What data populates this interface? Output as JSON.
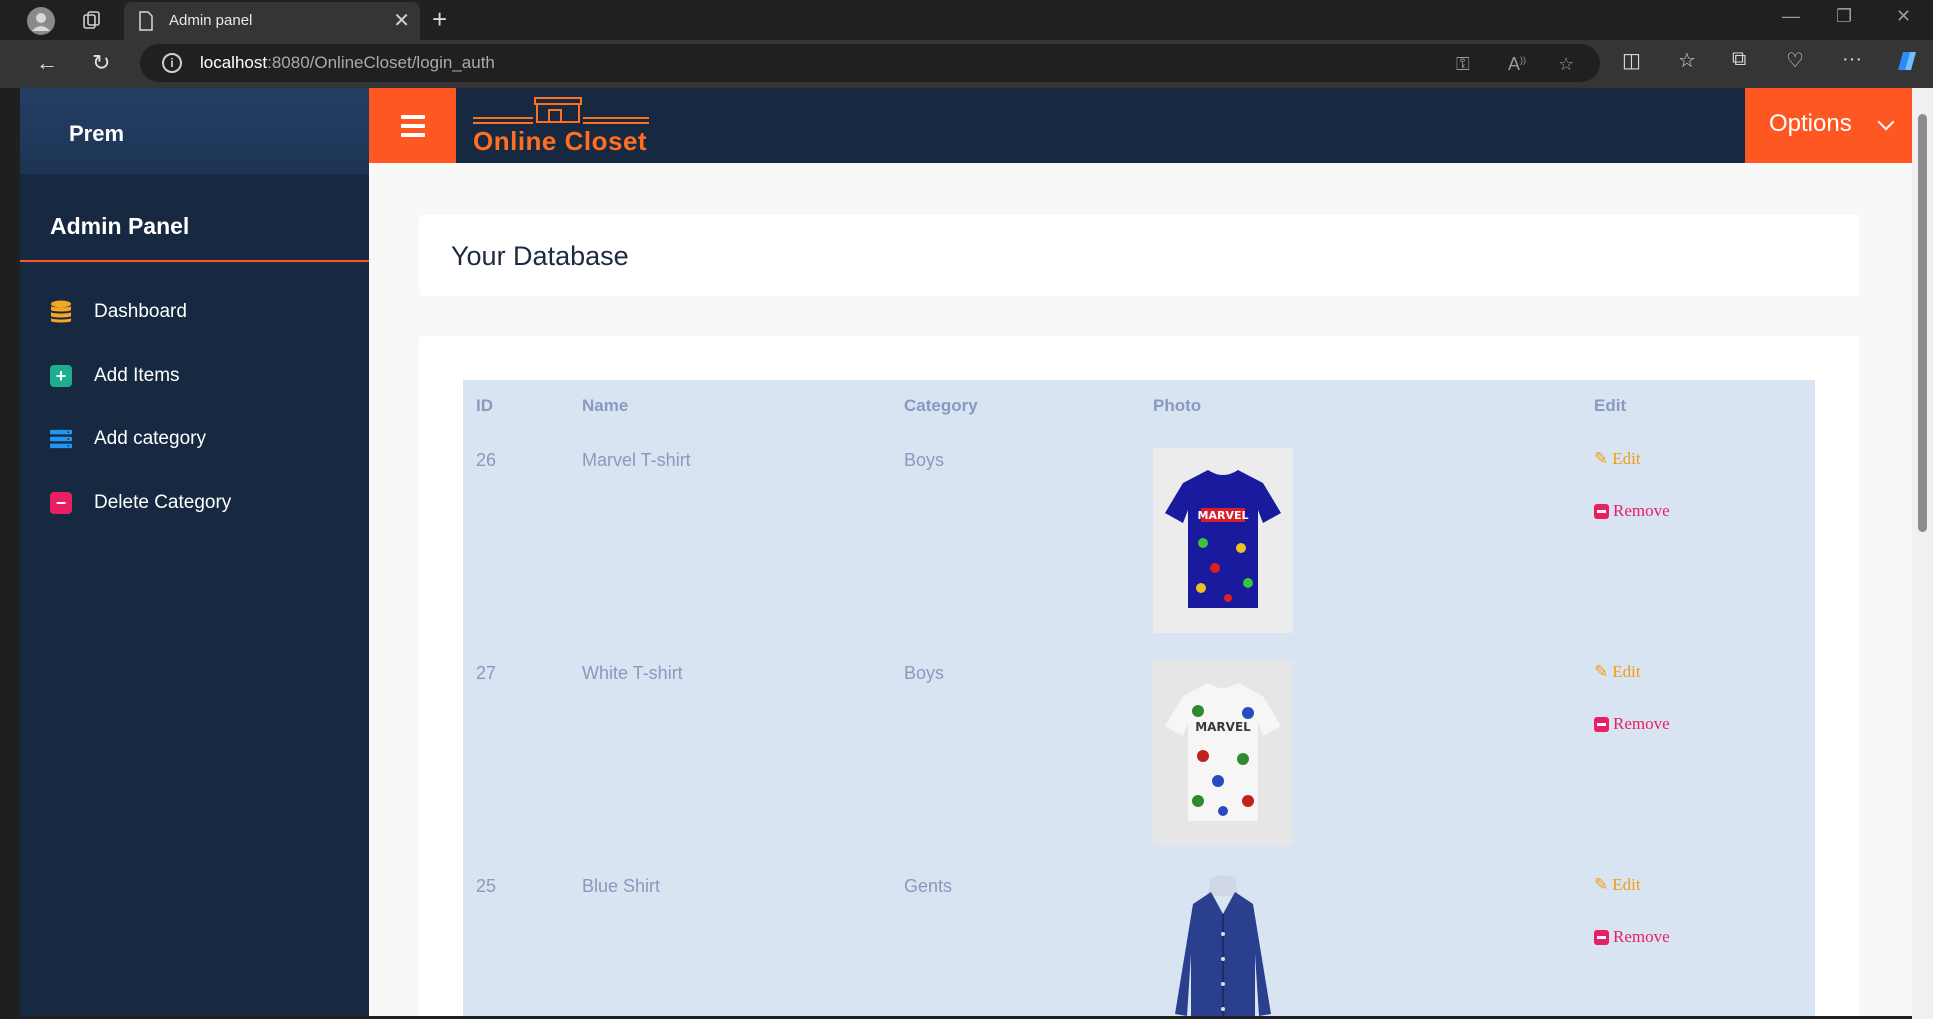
{
  "browser": {
    "tab_title": "Admin panel",
    "url_host": "localhost",
    "url_rest": ":8080/OnlineCloset/login_auth"
  },
  "sidebar": {
    "user": "Prem",
    "panel_title": "Admin Panel",
    "items": [
      {
        "label": "Dashboard",
        "icon": "database-icon",
        "color": "#f5a623"
      },
      {
        "label": "Add Items",
        "icon": "plus-square-icon",
        "color": "#1fae8f"
      },
      {
        "label": "Add category",
        "icon": "server-icon",
        "color": "#2196f3"
      },
      {
        "label": "Delete Category",
        "icon": "minus-square-icon",
        "color": "#e91e63"
      }
    ]
  },
  "topbar": {
    "logo_text": "Online Closet",
    "options_label": "Options"
  },
  "main": {
    "heading": "Your Database",
    "table": {
      "headers": [
        "ID",
        "Name",
        "Category",
        "Photo",
        "Edit"
      ],
      "rows": [
        {
          "id": "26",
          "name": "Marvel T-shirt",
          "category": "Boys",
          "edit": "Edit",
          "remove": "Remove"
        },
        {
          "id": "27",
          "name": "White T-shirt",
          "category": "Boys",
          "edit": "Edit",
          "remove": "Remove"
        },
        {
          "id": "25",
          "name": "Blue Shirt",
          "category": "Gents",
          "edit": "Edit",
          "remove": "Remove"
        }
      ]
    }
  },
  "colors": {
    "accent": "#ff5722",
    "sidebar_bg": "#172841",
    "table_bg": "#d9e4f2",
    "edit": "#f39c12",
    "remove": "#e91e63"
  }
}
